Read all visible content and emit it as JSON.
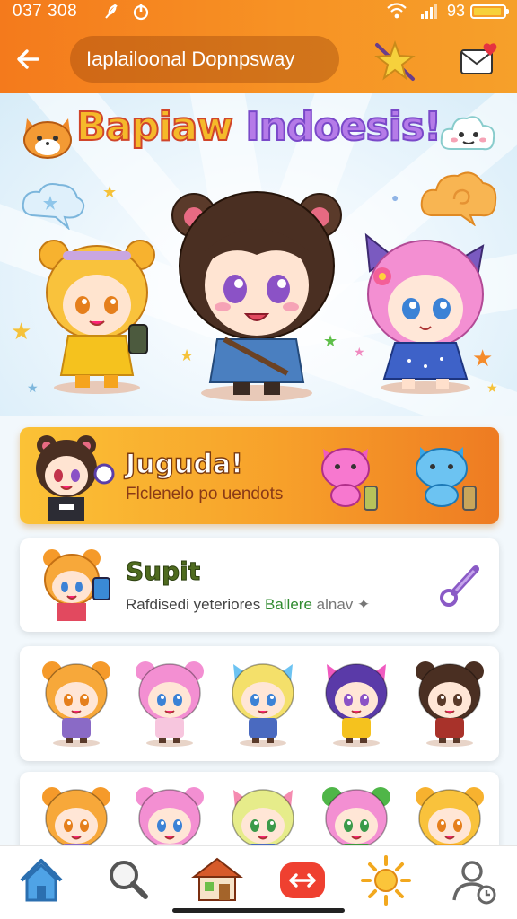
{
  "status_bar": {
    "time": "037 308",
    "battery_text": "93",
    "battery_level": 0.93,
    "icons": [
      "feather-icon",
      "power-icon",
      "wifi-icon",
      "signal-icon",
      "battery-icon"
    ]
  },
  "header": {
    "back_icon": "arrow-left-icon",
    "search_text": "Iaplailoonal Dopnpsway",
    "actions": [
      "magic-wand-star-icon",
      "mail-heart-icon"
    ]
  },
  "hero": {
    "title_part1": "Bapiaw",
    "title_part2": "Indoesis!",
    "characters": [
      "bear-ear-brown-hair-character",
      "blonde-bear-character",
      "pink-cat-ear-character"
    ]
  },
  "featured_banner": {
    "title": "Juguda!",
    "subtitle": "Flclenelo po uendots",
    "icons": [
      "pink-cat-icon",
      "blue-cat-icon"
    ]
  },
  "second_card": {
    "title": "Supit",
    "subtitle_prefix": "Rafdisedi yeteriores",
    "subtitle_highlight": "Ballere",
    "subtitle_tail": "alnav",
    "action_icon": "purple-key-icon"
  },
  "character_grid": {
    "row1": [
      "orange-bear-chibi",
      "pink-bear-chibi",
      "blonde-cat-chibi",
      "purple-flower-chibi",
      "brown-bear-chibi"
    ],
    "row2": [
      "orange-bear-chibi-2",
      "pink-bear-chibi-2",
      "flower-blonde-chibi",
      "green-frog-hat-chibi",
      "yellow-bear-chibi"
    ]
  },
  "bottom_nav": {
    "items": [
      "home-icon",
      "search-icon",
      "house-shop-icon",
      "swap-arrows-icon",
      "sun-icon",
      "profile-clock-icon"
    ],
    "active": "home-icon"
  },
  "colors": {
    "header_orange": "#f47a1c",
    "banner_gold": "#fbc236",
    "accent_green": "#2e8a2e",
    "nav_active_blue": "#3b8fd6"
  }
}
